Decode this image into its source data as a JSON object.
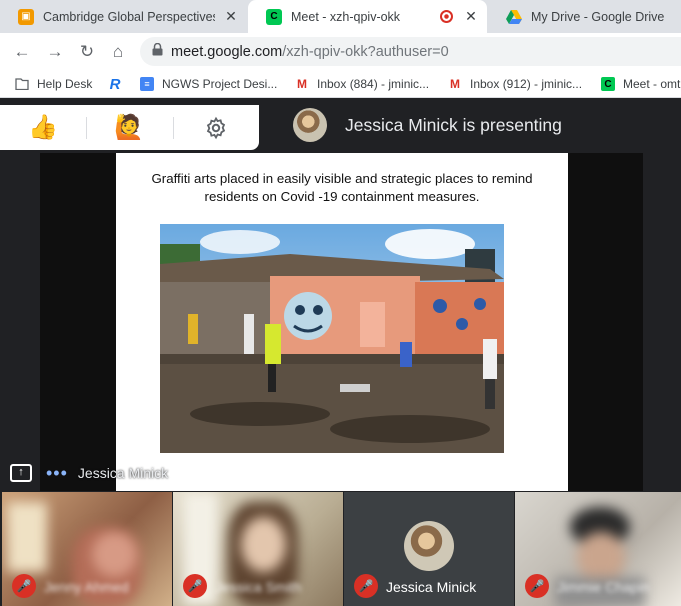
{
  "browser": {
    "tabs": [
      {
        "title": "Cambridge Global Perspectives &",
        "favicon": "classroom-icon",
        "color": "#f29900",
        "active": false
      },
      {
        "title": "Meet - xzh-qpiv-okk",
        "favicon": "meet-icon",
        "color": "#00c853",
        "active": true
      },
      {
        "title": "My Drive - Google Drive",
        "favicon": "drive-icon",
        "color": "#1a73e8",
        "active": false
      }
    ],
    "url_host": "meet.google.com",
    "url_path": "/xzh-qpiv-okk?authuser=0",
    "bookmarks": [
      {
        "label": "Help Desk",
        "icon": "folder-icon"
      },
      {
        "label": "",
        "icon": "r-logo-icon"
      },
      {
        "label": "NGWS Project Desi...",
        "icon": "docs-icon"
      },
      {
        "label": "Inbox (884) - jminic...",
        "icon": "gmail-icon"
      },
      {
        "label": "Inbox (912) - jminic...",
        "icon": "gmail-icon"
      },
      {
        "label": "Meet - omt",
        "icon": "meet-icon"
      }
    ]
  },
  "meet": {
    "reactions": [
      "thumbs-up-icon",
      "raise-hand-icon",
      "settings-icon"
    ],
    "presenting_label": "Jessica Minick is presenting",
    "slide_caption": "Graffiti arts placed in easily visible and strategic places to remind residents on Covid -19 containment measures.",
    "pinned_name": "Jessica Minick",
    "participants": [
      {
        "name": "Jenny Ahmed",
        "muted": true,
        "blurred": true
      },
      {
        "name": "Jessica Smith",
        "muted": true,
        "blurred": true
      },
      {
        "name": "Jessica Minick",
        "muted": true,
        "blurred": false
      },
      {
        "name": "Jimmie Chapin",
        "muted": true,
        "blurred": true
      }
    ]
  },
  "colors": {
    "meet_bg": "#202124",
    "mute_red": "#d93025",
    "chrome_tabstrip": "#dee1e6"
  }
}
